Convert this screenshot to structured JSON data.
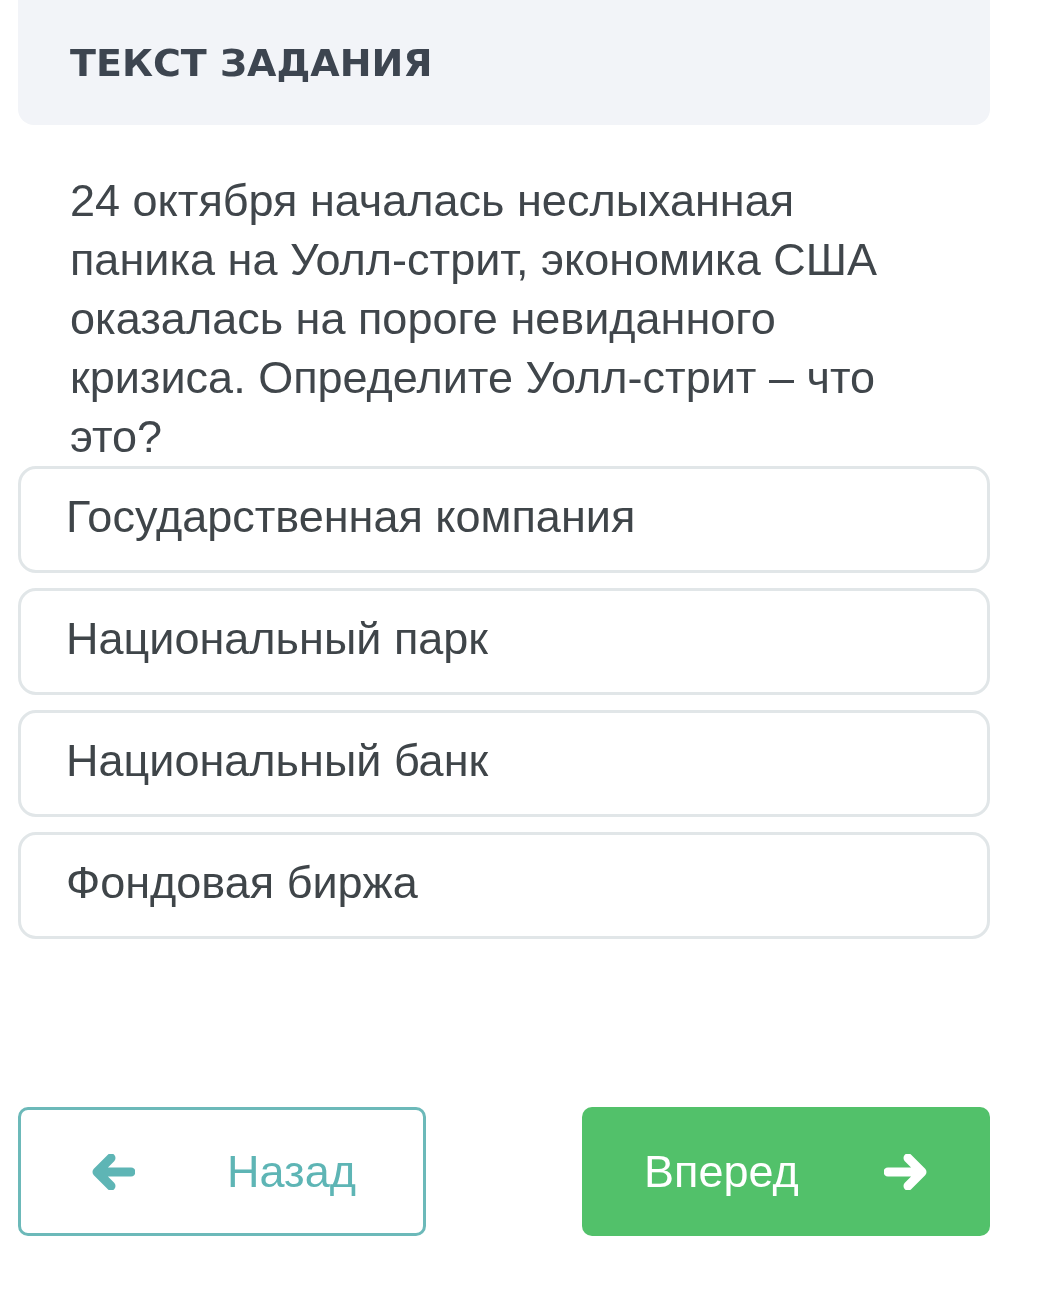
{
  "task_header": {
    "title": "ТЕКСТ ЗАДАНИЯ"
  },
  "question": "24 октября началась неслыханная паника на Уолл-стрит, экономика США оказалась на пороге невиданного кризиса. Определите Уолл-стрит – что это?",
  "options": [
    {
      "label": "Государственная компания",
      "selected": false
    },
    {
      "label": "Национальный парк",
      "selected": false
    },
    {
      "label": "Национальный банк",
      "selected": false
    },
    {
      "label": "Фондовая биржа",
      "selected": false
    }
  ],
  "navigation": [
    {
      "kind": "back",
      "label": "Назад"
    },
    {
      "kind": "forward",
      "label": "Вперед"
    }
  ]
}
